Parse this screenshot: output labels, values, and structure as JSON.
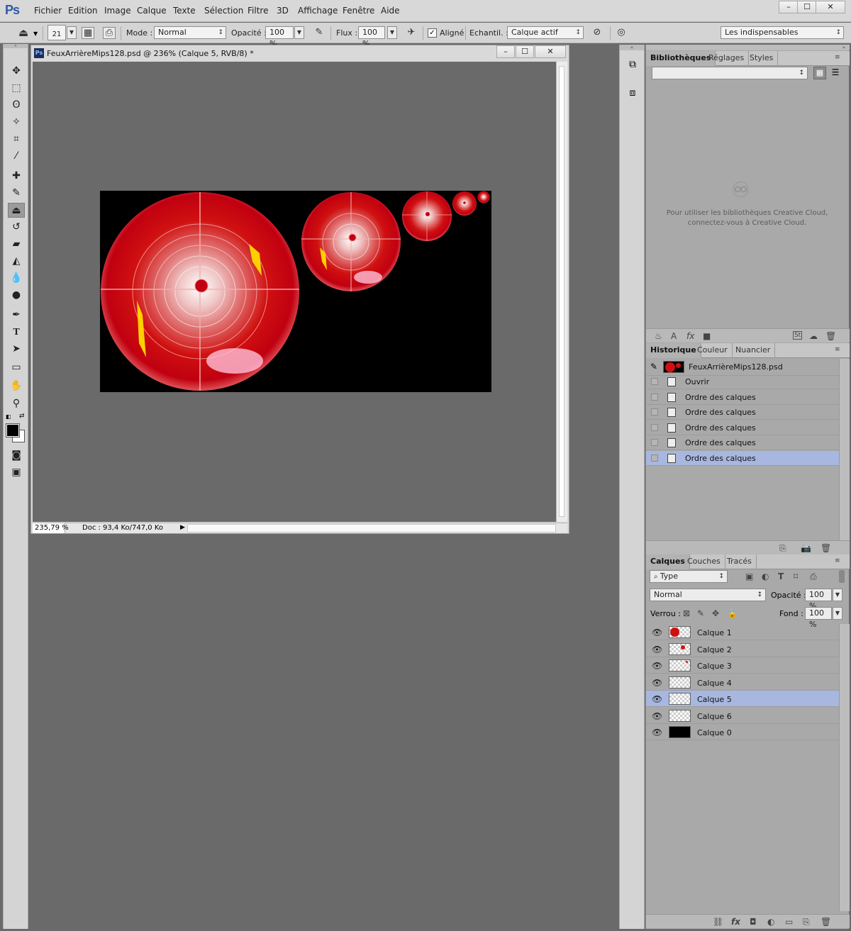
{
  "app": {
    "logo": "Ps"
  },
  "menu": [
    "Fichier",
    "Edition",
    "Image",
    "Calque",
    "Texte",
    "Sélection",
    "Filtre",
    "3D",
    "Affichage",
    "Fenêtre",
    "Aide"
  ],
  "window_controls": {
    "minimize": "–",
    "maximize": "☐",
    "close": "✕"
  },
  "options": {
    "brush_size": "21",
    "mode_label": "Mode :",
    "mode_value": "Normal",
    "opacity_label": "Opacité :",
    "opacity_value": "100 %",
    "flux_label": "Flux :",
    "flux_value": "100 %",
    "aligned_label": "Aligné",
    "sample_label": "Echantil. :",
    "sample_value": "Calque actif",
    "workspace": "Les indispensables"
  },
  "tools": [
    "move-icon",
    "marquee-icon",
    "lasso-icon",
    "magic-wand-icon",
    "crop-icon",
    "eyedropper-icon",
    "healing-icon",
    "brush-icon",
    "clone-stamp-icon",
    "history-brush-icon",
    "eraser-icon",
    "paint-bucket-icon",
    "blur-icon",
    "dodge-icon",
    "pen-icon",
    "type-icon",
    "path-select-icon",
    "rectangle-icon",
    "hand-icon",
    "zoom-icon"
  ],
  "document": {
    "title": "FeuxArrièreMips128.psd @ 236% (Calque 5, RVB/8) *",
    "zoom": "235,79 %",
    "doc_size": "Doc : 93,4 Ko/747,0 Ko"
  },
  "libraries": {
    "tabs": [
      "Bibliothèques",
      "Réglages",
      "Styles"
    ],
    "message_line1": "Pour utiliser les bibliothèques Creative Cloud,",
    "message_line2": "connectez-vous à Creative Cloud."
  },
  "history": {
    "tabs": [
      "Historique",
      "Couleur",
      "Nuancier"
    ],
    "snapshot": "FeuxArrièreMips128.psd",
    "items": [
      "Ouvrir",
      "Ordre des calques",
      "Ordre des calques",
      "Ordre des calques",
      "Ordre des calques",
      "Ordre des calques"
    ],
    "selected_index": 5
  },
  "layers": {
    "tabs": [
      "Calques",
      "Couches",
      "Tracés"
    ],
    "filter": "Type",
    "blend_mode": "Normal",
    "opacity_label": "Opacité :",
    "opacity_value": "100 %",
    "lock_label": "Verrou :",
    "fill_label": "Fond :",
    "fill_value": "100 %",
    "items": [
      "Calque 1",
      "Calque 2",
      "Calque 3",
      "Calque 4",
      "Calque 5",
      "Calque 6",
      "Calque 0"
    ],
    "selected_index": 4
  },
  "colors": {
    "accent_selection": "#a8b7df",
    "panel_bg": "#a9a9a9",
    "canvas_bg": "#6a6a6a"
  }
}
